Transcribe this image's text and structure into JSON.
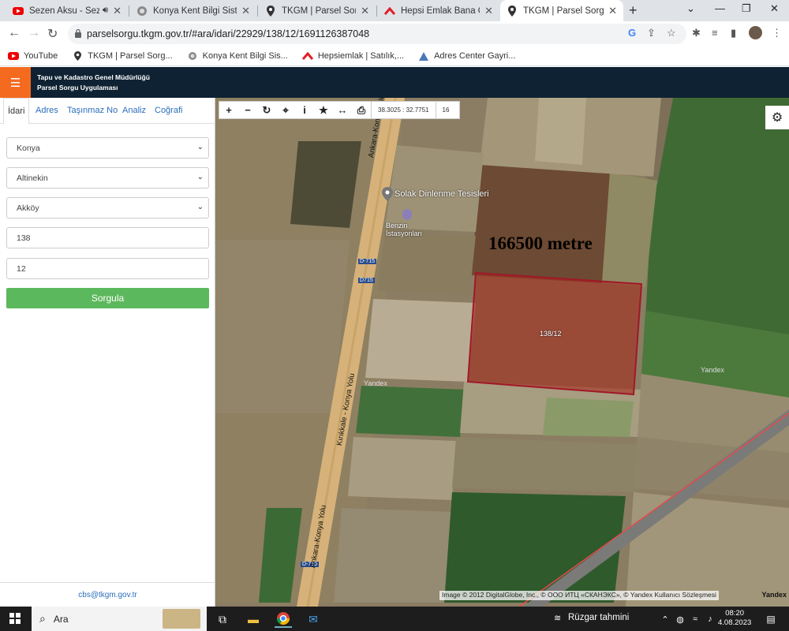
{
  "browser": {
    "tabs": [
      {
        "title": "Sezen Aksu - Sezen A",
        "icon": "youtube-icon",
        "audio": true
      },
      {
        "title": "Konya Kent Bilgi Sistemi",
        "icon": "konya-icon"
      },
      {
        "title": "TKGM | Parsel Sorgu Uyg",
        "icon": "map-pin-icon"
      },
      {
        "title": "Hepsi Emlak Bana Özel",
        "icon": "hepsiemlak-icon"
      },
      {
        "title": "TKGM | Parsel Sorgu Uyg",
        "icon": "map-pin-icon",
        "active": true
      }
    ],
    "url": "parselsorgu.tkgm.gov.tr/#ara/idari/22929/138/12/1691126387048",
    "bookmarks": [
      {
        "label": "YouTube",
        "icon": "youtube-icon"
      },
      {
        "label": "TKGM | Parsel Sorg...",
        "icon": "map-pin-icon"
      },
      {
        "label": "Konya Kent Bilgi Sis...",
        "icon": "konya-icon"
      },
      {
        "label": "Hepsiemlak | Satılık,...",
        "icon": "hepsiemlak-icon"
      },
      {
        "label": "Adres Center Gayri...",
        "icon": "adres-icon"
      }
    ]
  },
  "app": {
    "title_line1": "Tapu ve Kadastro Genel Müdürlüğü",
    "title_line2": "Parsel Sorgu Uygulaması"
  },
  "side": {
    "tabs": [
      "İdari",
      "Adres",
      "Taşınmaz No",
      "Analiz",
      "Coğrafi"
    ],
    "active_tab": "İdari",
    "il": "Konya",
    "ilce": "Altinekin",
    "mahalle": "Akköy",
    "ada": "138",
    "parsel": "12",
    "submit_label": "Sorgula",
    "footer_email": "cbs@tkgm.gov.tr"
  },
  "map": {
    "coords": "38.3025 : 32.7751",
    "zoom": "16",
    "overlay_text": "166500 metre",
    "parcel_label": "138/12",
    "poi_name": "Solak Dinlenme Tesisleri",
    "poi2_name": "Benzin İstasyonları",
    "road_badge_1": "D-715",
    "road_badge_2": "D715",
    "road_badge_3": "D-715",
    "road_name_1": "Ankara-Konya Yolu",
    "road_name_2": "Kırıkkale - Konya Yolu",
    "road_name_3": "Ankara-Konya Yolu",
    "watermark": "Yandex",
    "attribution": "Image © 2012 DigitalGlobe, Inc., © ООО ИТЦ «СКАНЭКС», © Yandex Kullanıcı Sözleşmesi",
    "logo": "Yandex"
  },
  "taskbar": {
    "search_placeholder": "Ara",
    "weather": "Rüzgar tahmini",
    "time": "08:20",
    "date": "4.08.2023"
  },
  "colors": {
    "header_bg": "#0e2233",
    "menu_orange": "#f46b20",
    "sorgula_green": "#5cb85c",
    "parcel_red": "#a01828"
  }
}
